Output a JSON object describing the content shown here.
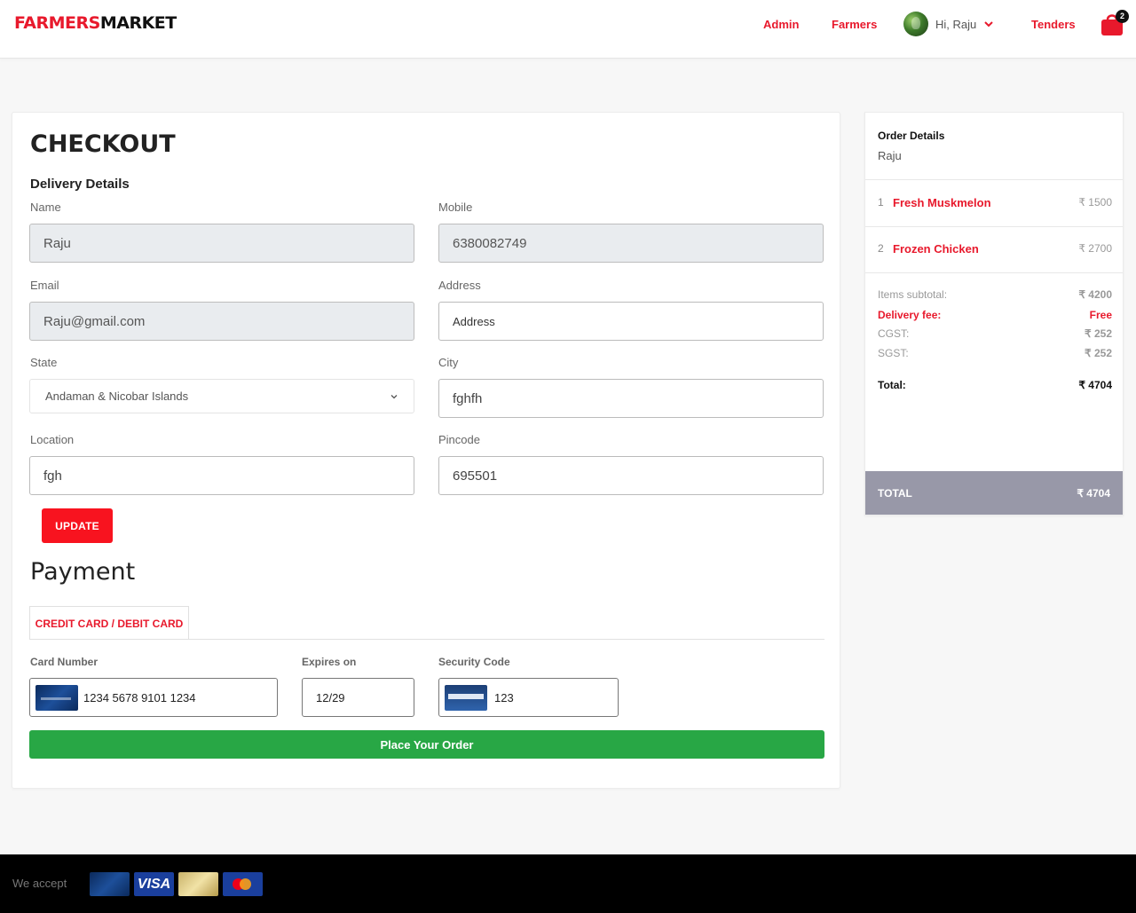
{
  "header": {
    "logo_part1": "FARMERS",
    "logo_part2": "MARKET",
    "nav": {
      "admin": "Admin",
      "farmers": "Farmers",
      "tenders": "Tenders"
    },
    "user_greeting": "Hi, Raju",
    "cart_count": "2",
    "brand_color": "#e8192c"
  },
  "checkout": {
    "title": "CHECKOUT",
    "delivery_title": "Delivery Details",
    "fields": {
      "name": {
        "label": "Name",
        "value": "Raju"
      },
      "mobile": {
        "label": "Mobile",
        "value": "6380082749"
      },
      "email": {
        "label": "Email",
        "value": "Raju@gmail.com"
      },
      "address": {
        "label": "Address",
        "value": "Address"
      },
      "state": {
        "label": "State",
        "value": "Andaman & Nicobar Islands"
      },
      "city": {
        "label": "City",
        "value": "fghfh"
      },
      "location": {
        "label": "Location",
        "value": "fgh"
      },
      "pincode": {
        "label": "Pincode",
        "value": "695501"
      }
    },
    "update_label": "UPDATE"
  },
  "payment": {
    "title": "Payment",
    "tab_label": "CREDIT CARD / DEBIT CARD",
    "card_number": {
      "label": "Card Number",
      "value": "1234 5678 9101 1234"
    },
    "expires": {
      "label": "Expires on",
      "value": "12/29"
    },
    "security": {
      "label": "Security Code",
      "value": "123"
    },
    "place_order_label": "Place Your Order",
    "place_order_color": "#28a745"
  },
  "order": {
    "title": "Order Details",
    "customer": "Raju",
    "items": [
      {
        "index": "1",
        "name": "Fresh Muskmelon",
        "price": "₹ 1500"
      },
      {
        "index": "2",
        "name": "Frozen Chicken",
        "price": "₹ 2700"
      }
    ],
    "summary": {
      "subtotal": {
        "label": "Items subtotal:",
        "value": "₹ 4200"
      },
      "delivery": {
        "label": "Delivery fee:",
        "value": "Free"
      },
      "cgst": {
        "label": "CGST:",
        "value": "₹ 252"
      },
      "sgst": {
        "label": "SGST:",
        "value": "₹ 252"
      },
      "total": {
        "label": "Total:",
        "value": "₹ 4704"
      }
    },
    "total_bar": {
      "label": "TOTAL",
      "value": "₹ 4704"
    }
  },
  "footer": {
    "we_accept": "We accept",
    "visa_text": "VISA",
    "payment_logos": [
      "card-logo",
      "visa-logo",
      "amex-logo",
      "mastercard-logo"
    ]
  }
}
